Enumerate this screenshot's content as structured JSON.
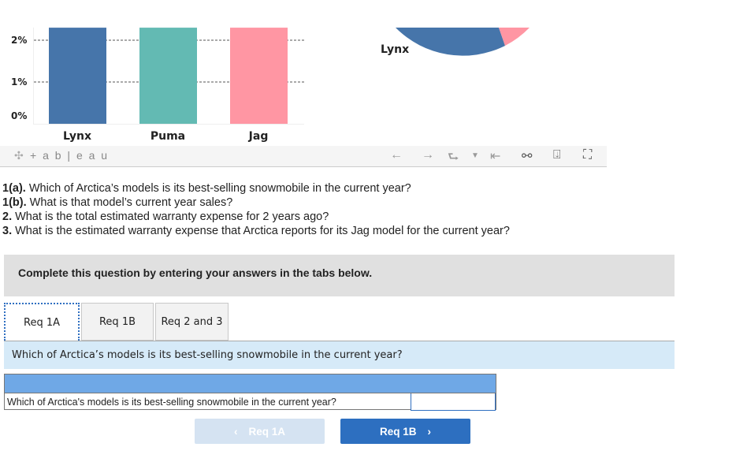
{
  "chart_data": [
    {
      "type": "bar",
      "categories": [
        "Lynx",
        "Puma",
        "Jag"
      ],
      "values": [
        2.3,
        2.3,
        2.3
      ],
      "yticks": [
        "0%",
        "1%",
        "2%"
      ],
      "ylim": [
        0,
        2.3
      ],
      "grid": true,
      "colors": [
        "#4675aa",
        "#63bab3",
        "#ff96a3"
      ]
    },
    {
      "type": "pie",
      "labels": [
        "Lynx"
      ],
      "colors": [
        "#4675aa",
        "#ff96a3"
      ]
    }
  ],
  "tableau": {
    "logo": "+ a b | e a u"
  },
  "questions": [
    {
      "num": "1(a).",
      "text": " Which of Arctica’s models is its best-selling snowmobile in the current year?"
    },
    {
      "num": "1(b).",
      "text": " What is that model’s current year sales?"
    },
    {
      "num": "2.",
      "text": " What is the total estimated warranty expense for 2 years ago?"
    },
    {
      "num": "3.",
      "text": " What is the estimated warranty expense that Arctica reports for its Jag model for the current year?"
    }
  ],
  "instruction": "Complete this question by entering your answers in the tabs below.",
  "tabs": [
    {
      "label": "Req 1A"
    },
    {
      "label": "Req 1B"
    },
    {
      "label": "Req 2 and 3"
    }
  ],
  "active_question": "Which of Arctica’s models is its best-selling snowmobile in the current year?",
  "table": {
    "row_label": "Which of Arctica's models is its best-selling snowmobile in the current year?",
    "answer": ""
  },
  "nav": {
    "prev": "Req 1A",
    "next": "Req 1B"
  }
}
